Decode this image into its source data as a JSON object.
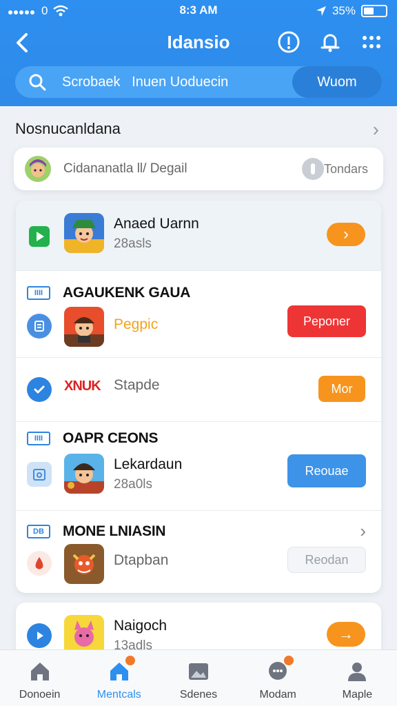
{
  "status_bar": {
    "carrier_glyph": "0",
    "time": "8:3 AM",
    "battery": "35%"
  },
  "header": {
    "title": "Idansio",
    "icons": [
      "info-icon",
      "bell-icon",
      "more-icon"
    ]
  },
  "search": {
    "left_text": "Scrobaek",
    "middle_text": "Inuen Uoduecin",
    "button_label": "Wuom"
  },
  "section": {
    "title": "Nosnucanldana"
  },
  "filter": {
    "text": "Cidananatla ll/ Degail",
    "right_label": "Tondars"
  },
  "list": {
    "item1": {
      "title": "Anaed Uarnn",
      "sub": "28asls",
      "button": "›"
    },
    "group1": {
      "badge": "IIII",
      "title": "AGAUKENK GAUA"
    },
    "item2": {
      "title": "Pegpic",
      "button": "Peponer"
    },
    "item3": {
      "brand": "XNUK",
      "title": "Stapde",
      "button": "Mor"
    },
    "group2": {
      "badge": "IIII",
      "title": "OAPR CEONS"
    },
    "item4": {
      "title": "Lekardaun",
      "sub": "28a0ls",
      "button": "Reouae"
    },
    "group3": {
      "badge": "DB",
      "title": "MONE LNIASIN"
    },
    "item5": {
      "title": "Dtapban",
      "button": "Reodan"
    }
  },
  "card2": {
    "title": "Naigoch",
    "sub": "13adls",
    "button": "→"
  },
  "tabs": [
    {
      "label": "Donoein",
      "icon": "home-icon"
    },
    {
      "label": "Mentcals",
      "icon": "home-active-icon"
    },
    {
      "label": "Sdenes",
      "icon": "image-icon"
    },
    {
      "label": "Modam",
      "icon": "chat-icon"
    },
    {
      "label": "Maple",
      "icon": "profile-icon"
    }
  ],
  "colors": {
    "primary": "#2d8ff0",
    "orange": "#f7941d",
    "red": "#ee3535",
    "blue_button": "#3d93e8"
  }
}
